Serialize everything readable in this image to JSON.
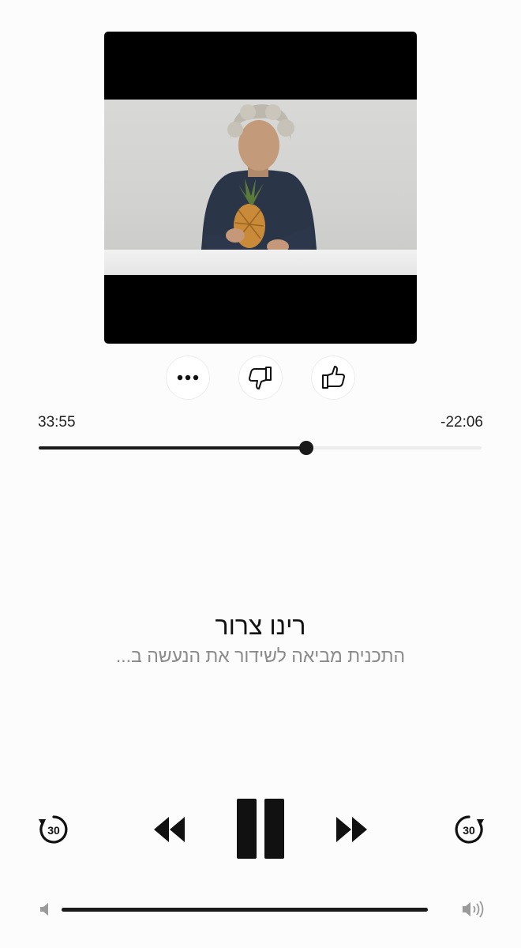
{
  "artwork": {
    "description_icon": "video-thumbnail-icon"
  },
  "actions": {
    "more_icon": "ellipsis-icon",
    "dislike_icon": "thumbs-down-icon",
    "like_icon": "thumbs-up-icon"
  },
  "playback": {
    "elapsed": "33:55",
    "remaining": "-22:06",
    "progress_fraction": 0.605
  },
  "track": {
    "title": "רינו צרור",
    "subtitle": "התכנית מביאה לשידור את הנעשה ב..."
  },
  "controls": {
    "skip_back_seconds": "30",
    "skip_forward_seconds": "30",
    "state": "playing"
  },
  "volume": {
    "level_fraction": 1.0
  },
  "colors": {
    "accent": "#1a1a1a",
    "track": "#ececec",
    "subtitle": "#8a8a8a"
  }
}
